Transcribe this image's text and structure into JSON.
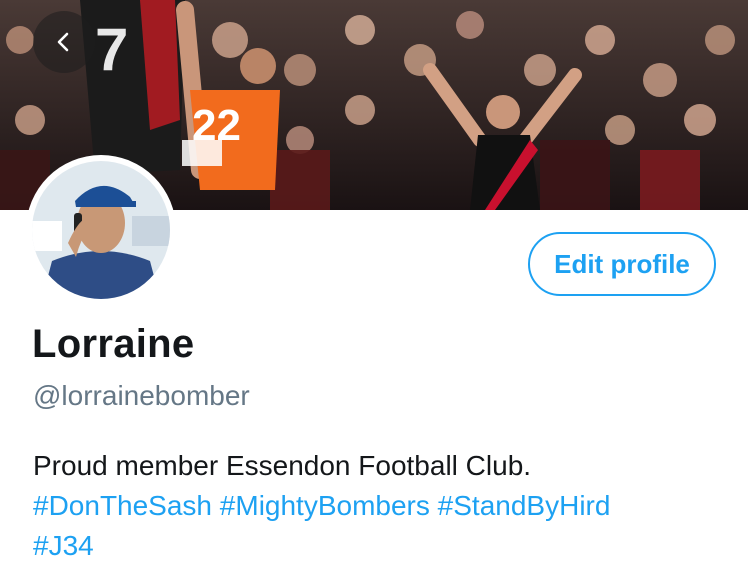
{
  "header": {
    "back_icon": "chevron-left-icon",
    "banner_image": "crowd-celebrating-footballer-banner"
  },
  "profile": {
    "avatar_image": "man-in-blue-cap-on-phone",
    "display_name": "Lorraine",
    "handle": "@lorrainebomber",
    "edit_button_label": "Edit profile",
    "bio_text": "Proud member Essendon Football Club.",
    "hashtags": [
      "#DonTheSash",
      "#MightyBombers",
      "#StandByHird",
      "#J34"
    ]
  },
  "colors": {
    "accent": "#1da1f2",
    "text_primary": "#14171a",
    "text_secondary": "#657786"
  }
}
